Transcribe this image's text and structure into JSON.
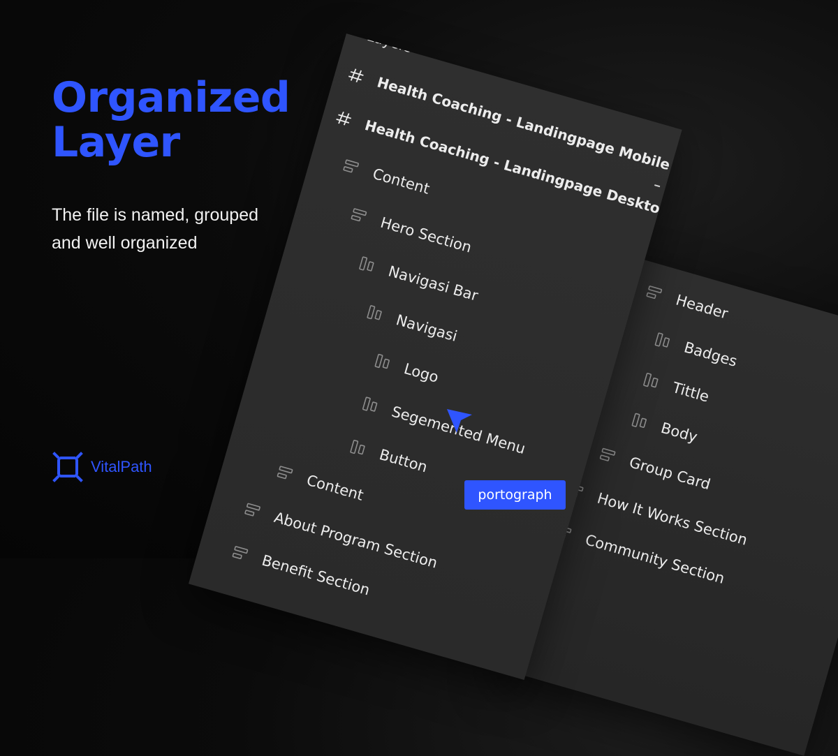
{
  "hero": {
    "title_line1": "Organized",
    "title_line2": "Layer",
    "subtitle": "The file is named, grouped and well organized"
  },
  "brand": {
    "name": "VitalPath",
    "logo_icon": "vitalpath-logo-icon",
    "color": "#2f55ff"
  },
  "front_panel": {
    "clipped_title": "Layers",
    "layers": [
      {
        "label": "Health Coaching - Landingpage Mobile",
        "icon": "hash-icon",
        "kind": "frame"
      },
      {
        "label": "Health Coaching - Landingpage Desktop",
        "icon": "hash-icon",
        "kind": "frame"
      },
      {
        "label": "Content",
        "icon": "align-left-icon",
        "kind": "group"
      },
      {
        "label": "Hero Section",
        "icon": "align-left-icon",
        "kind": "group"
      },
      {
        "label": "Navigasi Bar",
        "icon": "columns-icon",
        "kind": "group"
      },
      {
        "label": "Navigasi",
        "icon": "columns-icon",
        "kind": "group"
      },
      {
        "label": "Logo",
        "icon": "columns-icon",
        "kind": "group"
      },
      {
        "label": "Segemented Menu",
        "icon": "columns-icon",
        "kind": "group"
      },
      {
        "label": "Button",
        "icon": "columns-icon",
        "kind": "group"
      },
      {
        "label": "Content",
        "icon": "align-left-icon",
        "kind": "group"
      },
      {
        "label": "About Program Section",
        "icon": "align-left-icon",
        "kind": "group"
      },
      {
        "label": "Benefit Section",
        "icon": "align-left-icon",
        "kind": "group"
      }
    ]
  },
  "back_panel": {
    "layers": [
      {
        "label": "Header",
        "icon": "align-left-icon"
      },
      {
        "label": "Badges",
        "icon": "columns-icon"
      },
      {
        "label": "Tittle",
        "icon": "columns-icon"
      },
      {
        "label": "Body",
        "icon": "columns-icon"
      },
      {
        "label": "Group Card",
        "icon": "align-left-icon"
      },
      {
        "label": "How It Works Section",
        "icon": "align-left-icon"
      },
      {
        "label": "Community Section",
        "icon": "align-left-icon"
      }
    ]
  },
  "cursor": {
    "label": "portograph",
    "icon": "pointer-cursor-icon",
    "color": "#2f55ff"
  }
}
